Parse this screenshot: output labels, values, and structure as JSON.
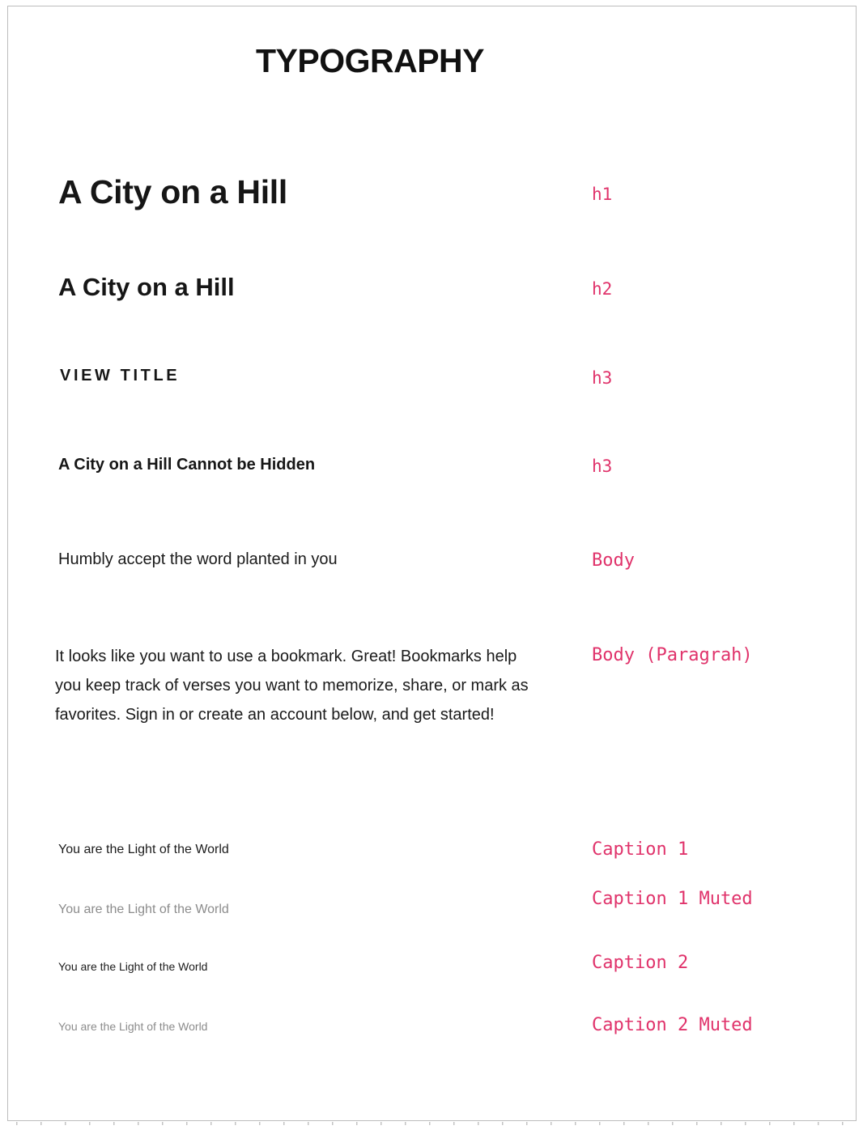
{
  "title": "TYPOGRAPHY",
  "styles": [
    {
      "sample": "A City on a Hill",
      "label": "h1"
    },
    {
      "sample": "A City on a Hill",
      "label": "h2"
    },
    {
      "sample": "VIEW TITLE",
      "label": "h3"
    },
    {
      "sample": "A City on a Hill Cannot be Hidden",
      "label": "h3"
    },
    {
      "sample": "Humbly accept the word planted in you",
      "label": "Body"
    },
    {
      "sample": "It looks like you want to use a bookmark. Great! Bookmarks help you keep track of verses you want to memorize, share, or mark as favorites. Sign in or create an account below, and get started!",
      "label": "Body (Paragrah)"
    },
    {
      "sample": "You are the Light of the World",
      "label": "Caption 1"
    },
    {
      "sample": "You are the Light of the World",
      "label": "Caption 1 Muted"
    },
    {
      "sample": "You are the Light of the World",
      "label": "Caption 2"
    },
    {
      "sample": "You are the Light of the World",
      "label": "Caption 2 Muted"
    }
  ],
  "colors": {
    "label": "#e0336b",
    "text": "#161616",
    "muted": "#8c8c8c"
  }
}
